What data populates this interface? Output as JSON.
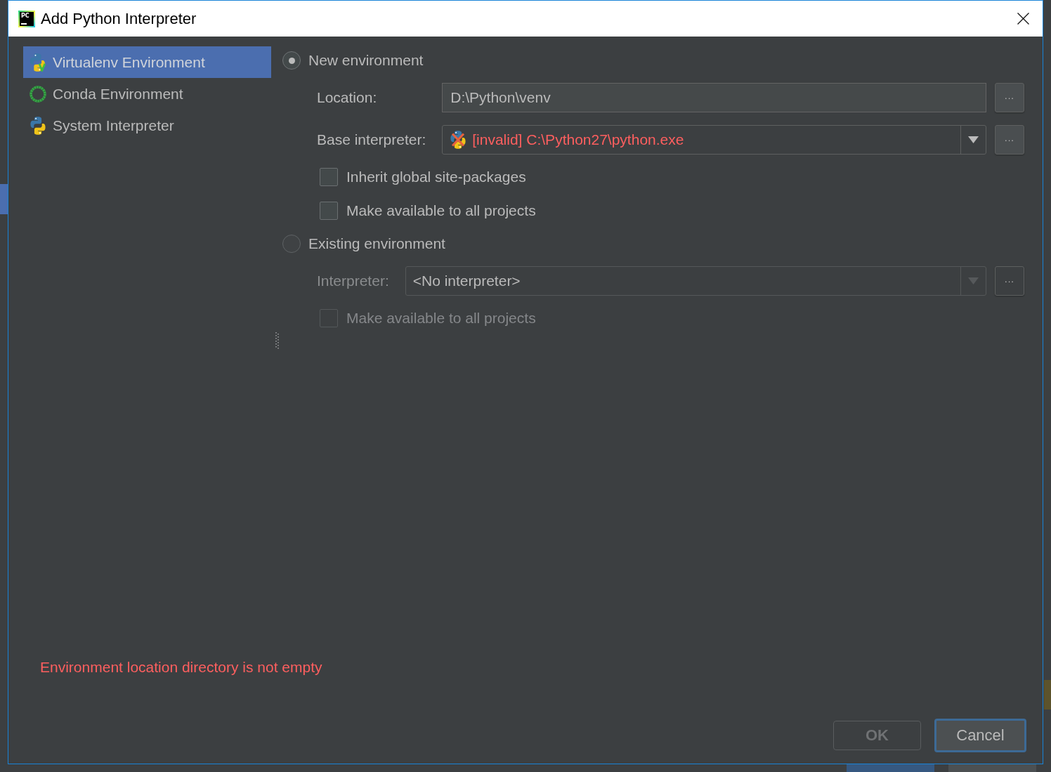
{
  "window": {
    "icon_label": "PC",
    "title": "Add Python Interpreter"
  },
  "sidebar": {
    "items": [
      {
        "kind": "virtualenv",
        "label": "Virtualenv Environment",
        "selected": true
      },
      {
        "kind": "conda",
        "label": "Conda Environment",
        "selected": false
      },
      {
        "kind": "system",
        "label": "System Interpreter",
        "selected": false
      }
    ]
  },
  "options": [
    {
      "label": "New environment",
      "selected": true,
      "fields": [
        {
          "kind": "text",
          "label": "Location:",
          "value": "D:\\Python\\venv",
          "disabled": false,
          "browse": "..."
        },
        {
          "kind": "combo",
          "label": "Base interpreter:",
          "value": "[invalid] C:\\Python27\\python.exe",
          "invalid": true,
          "disabled": false,
          "browse": "..."
        }
      ],
      "checkboxes": [
        {
          "label": "Inherit global site-packages",
          "checked": false,
          "disabled": false
        },
        {
          "label": "Make available to all projects",
          "checked": false,
          "disabled": false
        }
      ]
    },
    {
      "label": "Existing environment",
      "selected": false,
      "fields": [
        {
          "kind": "combo",
          "label": "Interpreter:",
          "value": "<No interpreter>",
          "invalid": false,
          "disabled": true,
          "browse": "..."
        }
      ],
      "checkboxes": [
        {
          "label": "Make available to all projects",
          "checked": false,
          "disabled": true
        }
      ]
    }
  ],
  "error": "Environment location directory is not empty",
  "buttons": [
    {
      "label": "OK",
      "disabled": true,
      "focused": false
    },
    {
      "label": "Cancel",
      "disabled": false,
      "focused": true
    }
  ]
}
